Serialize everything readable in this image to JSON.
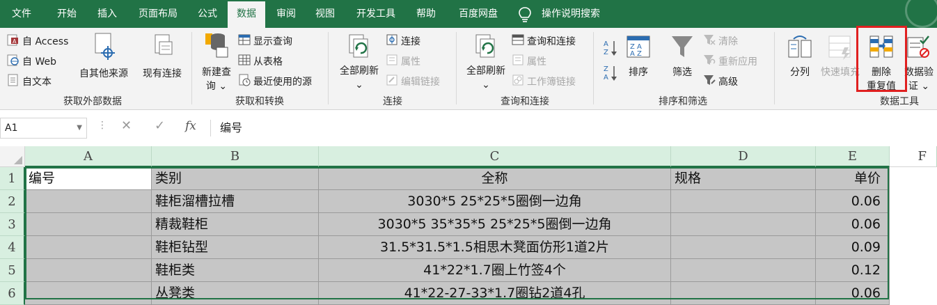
{
  "menu": {
    "tabs": [
      "文件",
      "开始",
      "插入",
      "页面布局",
      "公式",
      "数据",
      "审阅",
      "视图",
      "开发工具",
      "帮助",
      "百度网盘"
    ],
    "active_tab": "数据",
    "search_label": "操作说明搜索"
  },
  "ribbon": {
    "get_external": {
      "from_access": "自 Access",
      "from_web": "自 Web",
      "from_text": "自文本",
      "other_sources": "自其他来源",
      "existing": "现有连接",
      "group_label": "获取外部数据"
    },
    "get_transform": {
      "new_query_line1": "新建查",
      "new_query_line2": "询 ⌄",
      "show_queries": "显示查询",
      "from_table": "从表格",
      "recent_sources": "最近使用的源",
      "group_label": "获取和转换"
    },
    "connections": {
      "refresh_all": "全部刷新",
      "refresh_caret": "⌄",
      "connections": "连接",
      "properties": "属性",
      "edit_links": "编辑链接",
      "group_label": "连接"
    },
    "queries_connections": {
      "refresh_all": "全部刷新",
      "refresh_caret": "⌄",
      "queries_and_connections": "查询和连接",
      "properties": "属性",
      "workbook_links": "工作簿链接",
      "group_label": "查询和连接"
    },
    "sort_filter": {
      "sort": "排序",
      "filter": "筛选",
      "clear": "清除",
      "reapply": "重新应用",
      "advanced": "高级",
      "group_label": "排序和筛选"
    },
    "data_tools": {
      "split_column": "分列",
      "flash_fill": "快速填充",
      "remove_dup_line1": "删除",
      "remove_dup_line2": "重复值",
      "validation_line1": "数据验",
      "validation_line2": "证 ⌄",
      "group_label": "数据工具"
    }
  },
  "formula_bar": {
    "name_box": "A1",
    "fx": "fx",
    "content": "编号"
  },
  "sheet": {
    "columns": [
      "A",
      "B",
      "C",
      "D",
      "E",
      "F"
    ],
    "rows": [
      {
        "num": "1",
        "a": "编号",
        "b": "类别",
        "c": "全称",
        "d": "规格",
        "e": "单价"
      },
      {
        "num": "2",
        "a": "",
        "b": "鞋柜溜槽拉槽",
        "c": "3030*5    25*25*5圈倒一边角",
        "d": "",
        "e": "0.06"
      },
      {
        "num": "3",
        "a": "",
        "b": "精裁鞋柜",
        "c": "3030*5  35*35*5   25*25*5圈倒一边角",
        "d": "",
        "e": "0.06"
      },
      {
        "num": "4",
        "a": "",
        "b": "鞋柜钻型",
        "c": "31.5*31.5*1.5相思木凳面仿形1道2片",
        "d": "",
        "e": "0.09"
      },
      {
        "num": "5",
        "a": "",
        "b": "鞋柜类",
        "c": "41*22*1.7圈上竹签4个",
        "d": "",
        "e": "0.12"
      },
      {
        "num": "6",
        "a": "",
        "b": "丛凳类",
        "c": "41*22-27-33*1.7圈钻2道4孔",
        "d": "",
        "e": "0.06"
      }
    ]
  },
  "colors": {
    "accent": "#217346",
    "highlight": "#e02020",
    "selection_fill": "#c6c6c6"
  }
}
